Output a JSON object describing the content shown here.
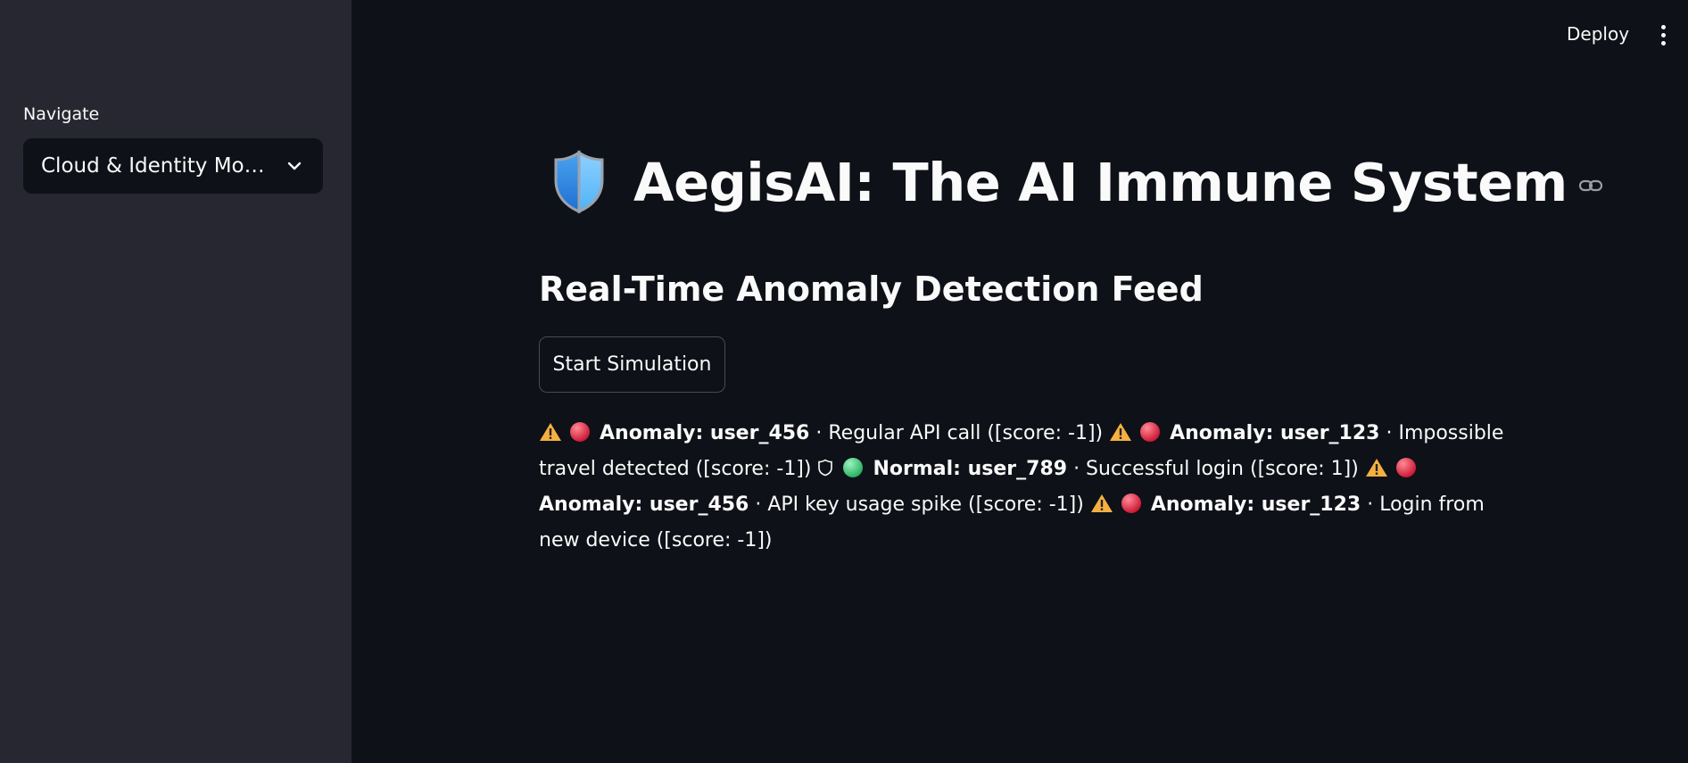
{
  "sidebar": {
    "nav_label": "Navigate",
    "select_value": "Cloud & Identity Mon…"
  },
  "header": {
    "deploy_label": "Deploy"
  },
  "main": {
    "title": "AegisAI: The AI Immune System",
    "subtitle": "Real-Time Anomaly Detection Feed",
    "start_button": "Start Simulation",
    "feed": [
      {
        "status": "anomaly",
        "heading": "Anomaly: user_456",
        "text": " · Regular API call ([score: -1])"
      },
      {
        "status": "anomaly",
        "heading": "Anomaly: user_123",
        "text": " · Impossible travel detected ([score: -1])"
      },
      {
        "status": "normal",
        "heading": "Normal: user_789",
        "text": " · Successful login ([score: 1])"
      },
      {
        "status": "anomaly",
        "heading": "Anomaly: user_456",
        "text": " · API key usage spike ([score: -1])"
      },
      {
        "status": "anomaly",
        "heading": "Anomaly: user_123",
        "text": " · Login from new device ([score: -1])"
      }
    ]
  },
  "colors": {
    "background": "#0e1117",
    "sidebar": "#262730",
    "text": "#fafafa",
    "anomaly_dot": "#e5324b",
    "normal_dot": "#3ddc84",
    "warning": "#f5b041"
  },
  "icons": {
    "title_icon": "shield-icon",
    "anchor_icon": "link-icon",
    "select_icon": "chevron-down-icon",
    "menu_icon": "kebab-menu-icon",
    "anomaly_icons": [
      "warning-icon",
      "red-circle-icon"
    ],
    "normal_icons": [
      "shield-outline-icon",
      "green-circle-icon"
    ]
  }
}
